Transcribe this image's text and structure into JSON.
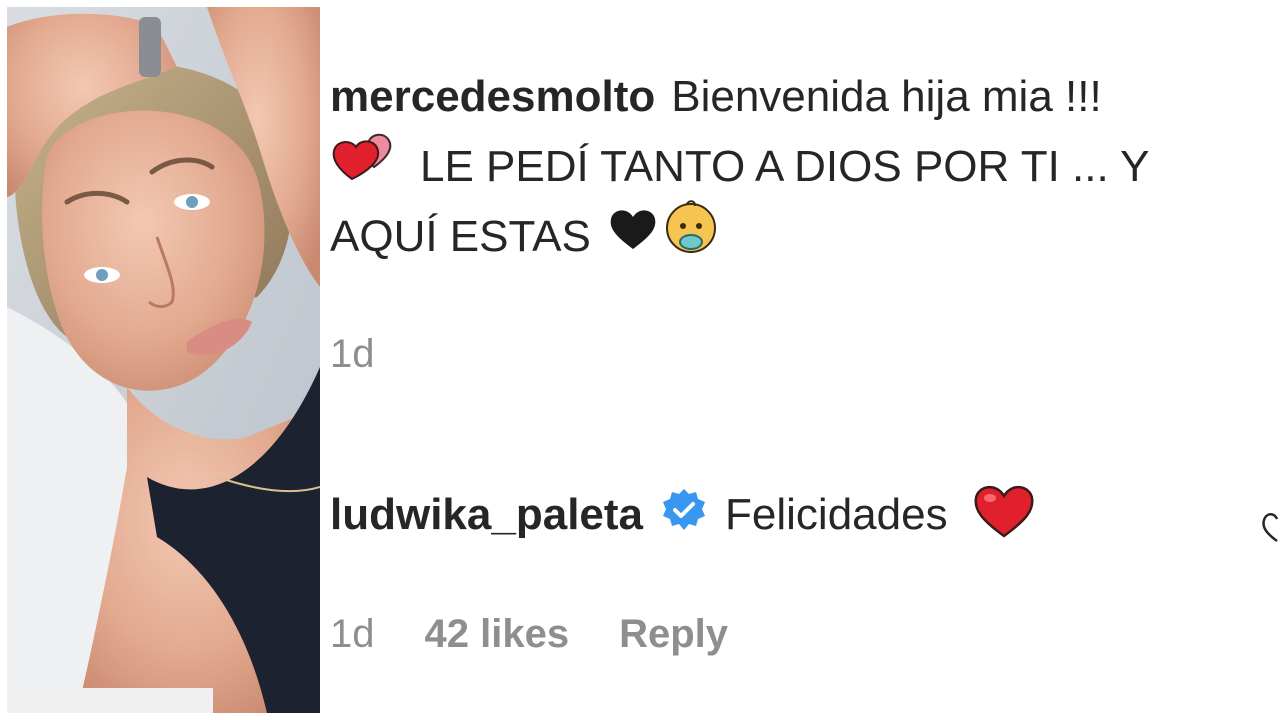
{
  "comments": [
    {
      "username": "mercedesmolto",
      "text_line1": "Bienvenida hija mia !!!",
      "text_line2": "LE PEDÍ TANTO A DIOS POR TI ... Y",
      "text_line3": "AQUÍ ESTAS",
      "emojis": [
        "two-hearts-icon",
        "black-heart-icon",
        "baby-icon"
      ],
      "time": "1d"
    },
    {
      "username": "ludwika_paleta",
      "verified": true,
      "text": "Felicidades",
      "emojis": [
        "red-heart-icon"
      ],
      "time": "1d",
      "likes": "42 likes",
      "reply_label": "Reply"
    }
  ],
  "colors": {
    "text": "#262626",
    "meta": "#8e8e8e",
    "verified": "#3897f0",
    "heart": "#e0202c"
  }
}
